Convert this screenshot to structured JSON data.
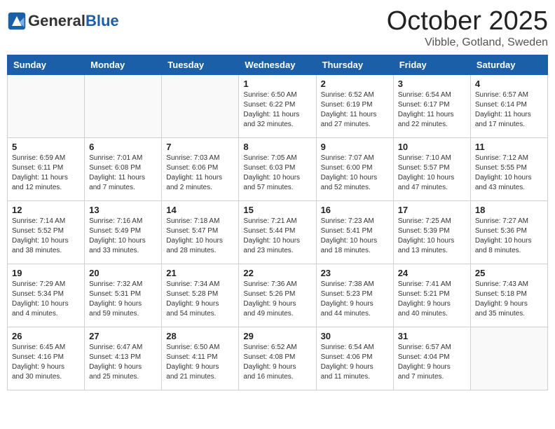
{
  "header": {
    "logo_general": "General",
    "logo_blue": "Blue",
    "month": "October 2025",
    "location": "Vibble, Gotland, Sweden"
  },
  "days_of_week": [
    "Sunday",
    "Monday",
    "Tuesday",
    "Wednesday",
    "Thursday",
    "Friday",
    "Saturday"
  ],
  "weeks": [
    [
      {
        "date": "",
        "info": ""
      },
      {
        "date": "",
        "info": ""
      },
      {
        "date": "",
        "info": ""
      },
      {
        "date": "1",
        "info": "Sunrise: 6:50 AM\nSunset: 6:22 PM\nDaylight: 11 hours\nand 32 minutes."
      },
      {
        "date": "2",
        "info": "Sunrise: 6:52 AM\nSunset: 6:19 PM\nDaylight: 11 hours\nand 27 minutes."
      },
      {
        "date": "3",
        "info": "Sunrise: 6:54 AM\nSunset: 6:17 PM\nDaylight: 11 hours\nand 22 minutes."
      },
      {
        "date": "4",
        "info": "Sunrise: 6:57 AM\nSunset: 6:14 PM\nDaylight: 11 hours\nand 17 minutes."
      }
    ],
    [
      {
        "date": "5",
        "info": "Sunrise: 6:59 AM\nSunset: 6:11 PM\nDaylight: 11 hours\nand 12 minutes."
      },
      {
        "date": "6",
        "info": "Sunrise: 7:01 AM\nSunset: 6:08 PM\nDaylight: 11 hours\nand 7 minutes."
      },
      {
        "date": "7",
        "info": "Sunrise: 7:03 AM\nSunset: 6:06 PM\nDaylight: 11 hours\nand 2 minutes."
      },
      {
        "date": "8",
        "info": "Sunrise: 7:05 AM\nSunset: 6:03 PM\nDaylight: 10 hours\nand 57 minutes."
      },
      {
        "date": "9",
        "info": "Sunrise: 7:07 AM\nSunset: 6:00 PM\nDaylight: 10 hours\nand 52 minutes."
      },
      {
        "date": "10",
        "info": "Sunrise: 7:10 AM\nSunset: 5:57 PM\nDaylight: 10 hours\nand 47 minutes."
      },
      {
        "date": "11",
        "info": "Sunrise: 7:12 AM\nSunset: 5:55 PM\nDaylight: 10 hours\nand 43 minutes."
      }
    ],
    [
      {
        "date": "12",
        "info": "Sunrise: 7:14 AM\nSunset: 5:52 PM\nDaylight: 10 hours\nand 38 minutes."
      },
      {
        "date": "13",
        "info": "Sunrise: 7:16 AM\nSunset: 5:49 PM\nDaylight: 10 hours\nand 33 minutes."
      },
      {
        "date": "14",
        "info": "Sunrise: 7:18 AM\nSunset: 5:47 PM\nDaylight: 10 hours\nand 28 minutes."
      },
      {
        "date": "15",
        "info": "Sunrise: 7:21 AM\nSunset: 5:44 PM\nDaylight: 10 hours\nand 23 minutes."
      },
      {
        "date": "16",
        "info": "Sunrise: 7:23 AM\nSunset: 5:41 PM\nDaylight: 10 hours\nand 18 minutes."
      },
      {
        "date": "17",
        "info": "Sunrise: 7:25 AM\nSunset: 5:39 PM\nDaylight: 10 hours\nand 13 minutes."
      },
      {
        "date": "18",
        "info": "Sunrise: 7:27 AM\nSunset: 5:36 PM\nDaylight: 10 hours\nand 8 minutes."
      }
    ],
    [
      {
        "date": "19",
        "info": "Sunrise: 7:29 AM\nSunset: 5:34 PM\nDaylight: 10 hours\nand 4 minutes."
      },
      {
        "date": "20",
        "info": "Sunrise: 7:32 AM\nSunset: 5:31 PM\nDaylight: 9 hours\nand 59 minutes."
      },
      {
        "date": "21",
        "info": "Sunrise: 7:34 AM\nSunset: 5:28 PM\nDaylight: 9 hours\nand 54 minutes."
      },
      {
        "date": "22",
        "info": "Sunrise: 7:36 AM\nSunset: 5:26 PM\nDaylight: 9 hours\nand 49 minutes."
      },
      {
        "date": "23",
        "info": "Sunrise: 7:38 AM\nSunset: 5:23 PM\nDaylight: 9 hours\nand 44 minutes."
      },
      {
        "date": "24",
        "info": "Sunrise: 7:41 AM\nSunset: 5:21 PM\nDaylight: 9 hours\nand 40 minutes."
      },
      {
        "date": "25",
        "info": "Sunrise: 7:43 AM\nSunset: 5:18 PM\nDaylight: 9 hours\nand 35 minutes."
      }
    ],
    [
      {
        "date": "26",
        "info": "Sunrise: 6:45 AM\nSunset: 4:16 PM\nDaylight: 9 hours\nand 30 minutes."
      },
      {
        "date": "27",
        "info": "Sunrise: 6:47 AM\nSunset: 4:13 PM\nDaylight: 9 hours\nand 25 minutes."
      },
      {
        "date": "28",
        "info": "Sunrise: 6:50 AM\nSunset: 4:11 PM\nDaylight: 9 hours\nand 21 minutes."
      },
      {
        "date": "29",
        "info": "Sunrise: 6:52 AM\nSunset: 4:08 PM\nDaylight: 9 hours\nand 16 minutes."
      },
      {
        "date": "30",
        "info": "Sunrise: 6:54 AM\nSunset: 4:06 PM\nDaylight: 9 hours\nand 11 minutes."
      },
      {
        "date": "31",
        "info": "Sunrise: 6:57 AM\nSunset: 4:04 PM\nDaylight: 9 hours\nand 7 minutes."
      },
      {
        "date": "",
        "info": ""
      }
    ]
  ]
}
